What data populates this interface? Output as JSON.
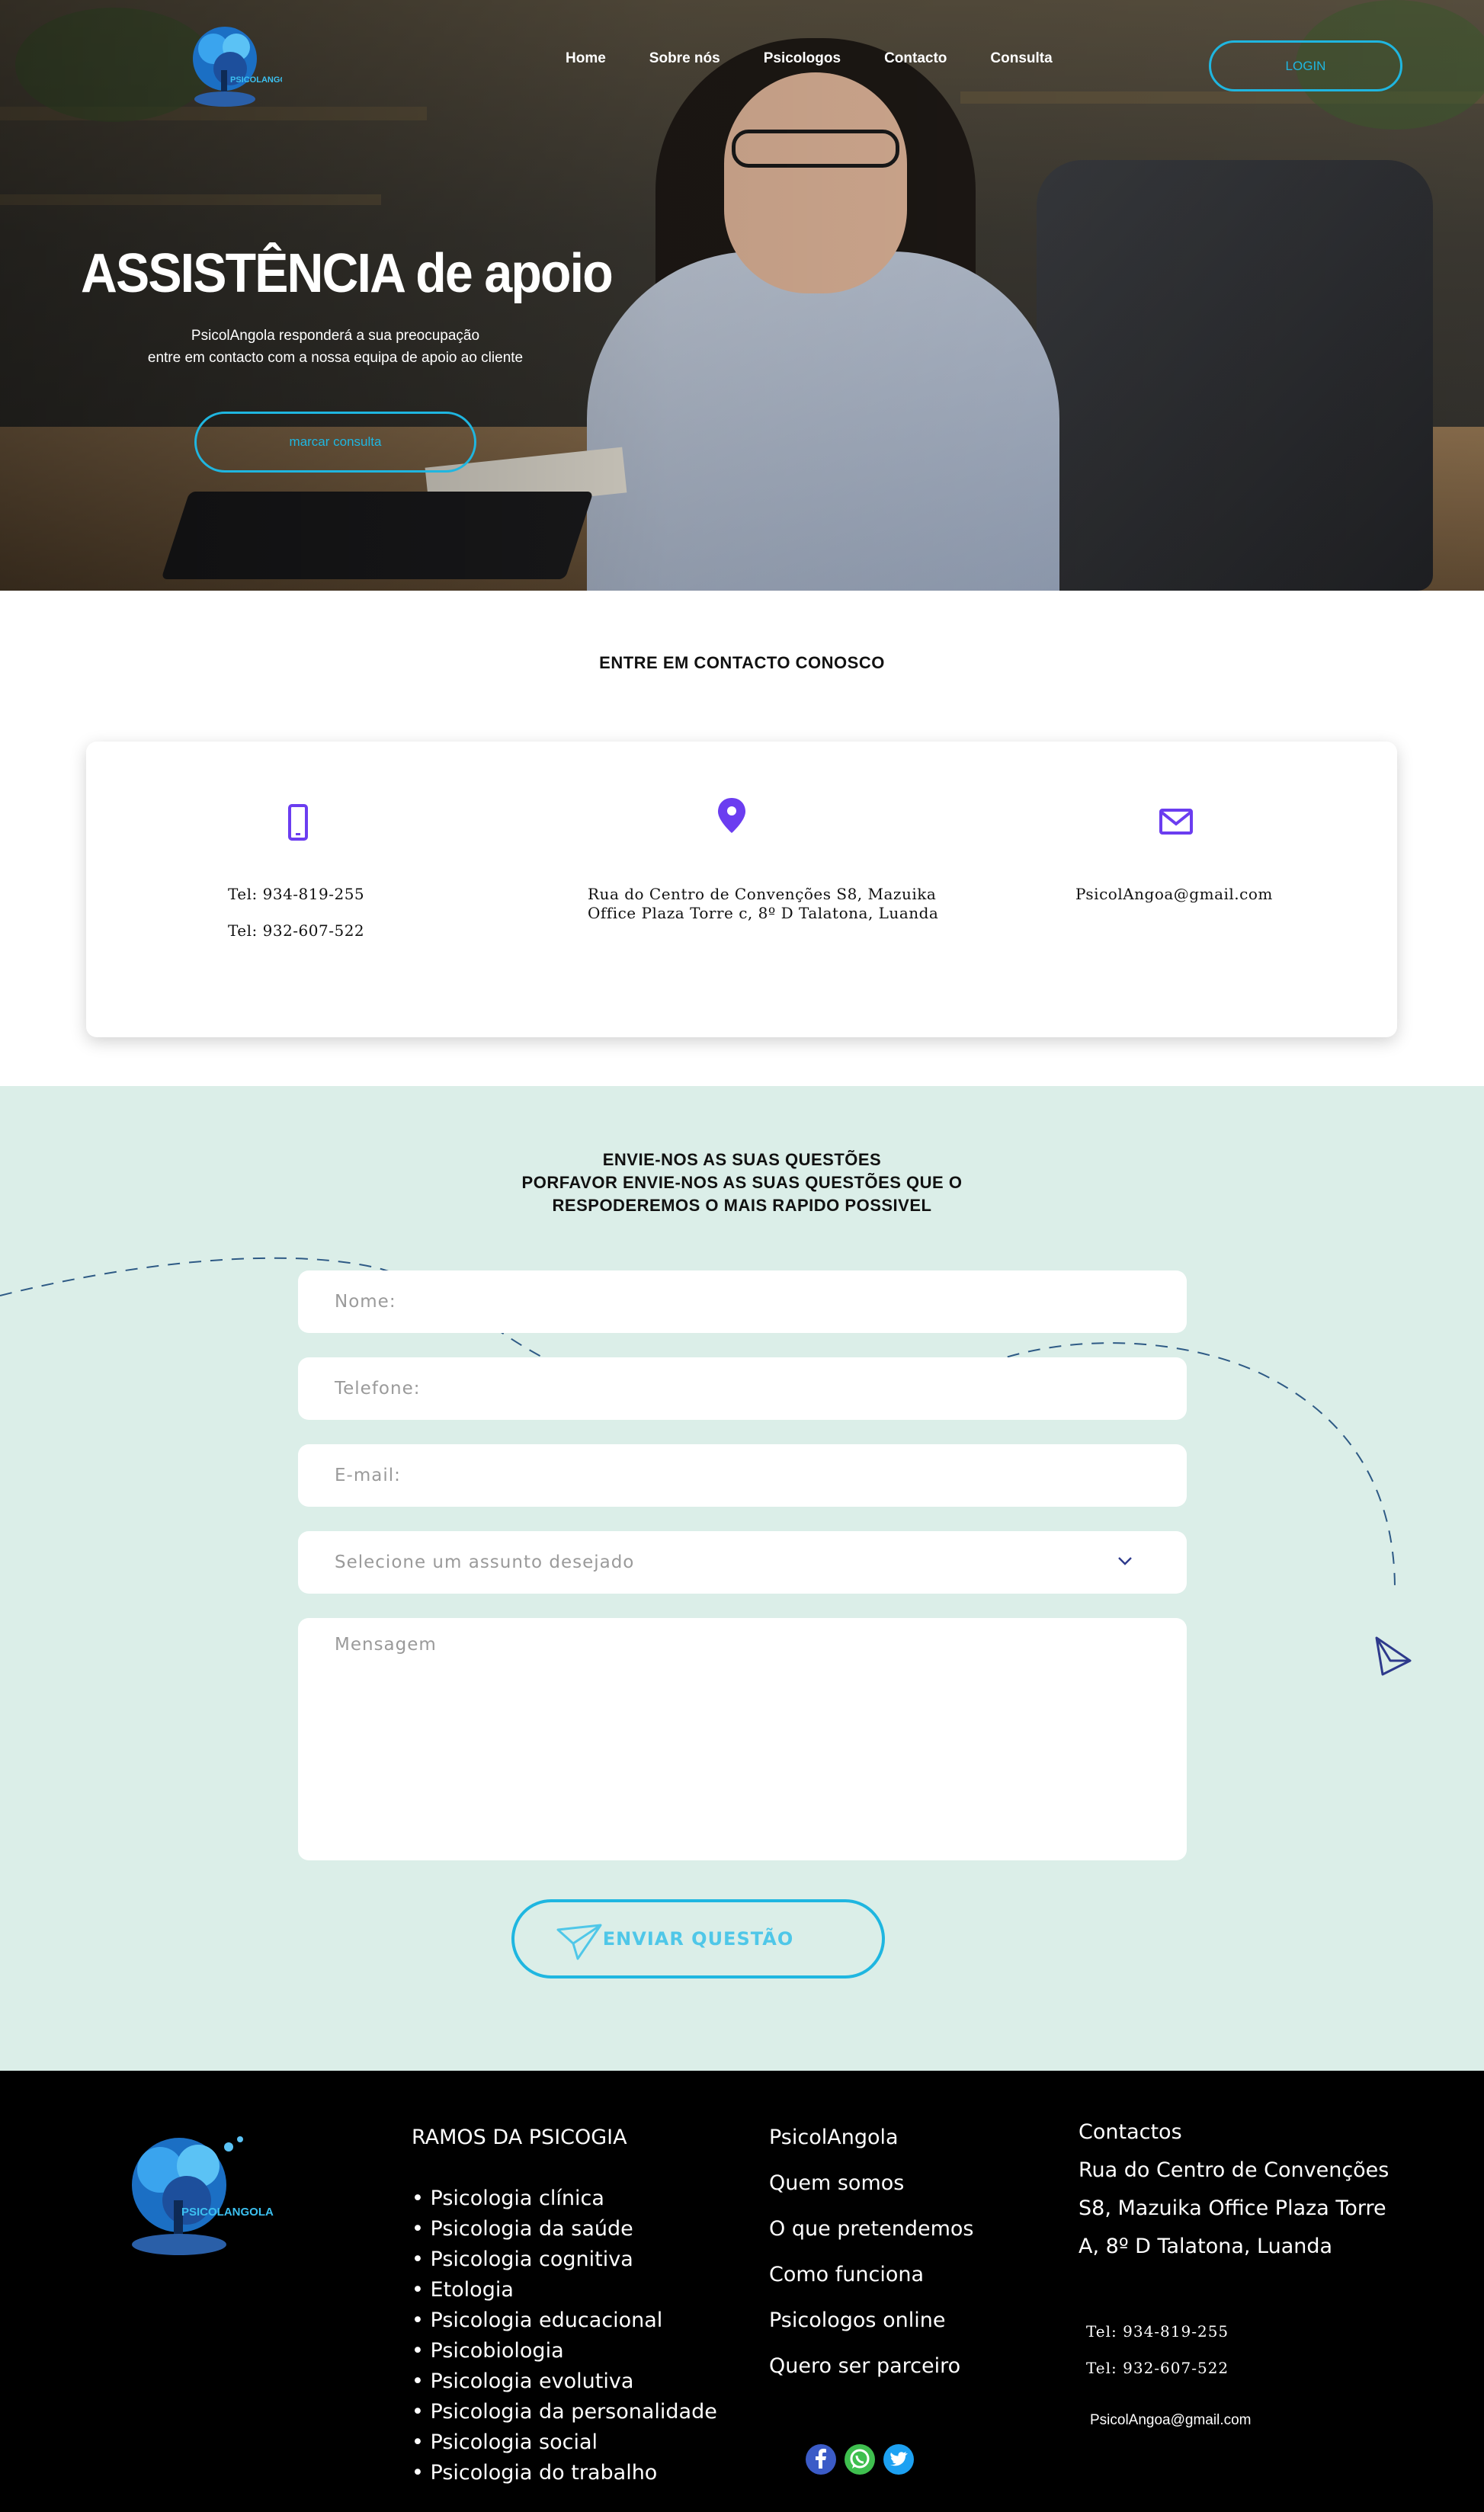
{
  "colors": {
    "accent": "#1fb6e0",
    "icon_purple": "#6b3df0",
    "form_bg": "#dbeee8",
    "footer_bg": "#000000"
  },
  "logo": {
    "text": "PSICOLANGOLA"
  },
  "nav": {
    "items": [
      {
        "label": "Home"
      },
      {
        "label": "Sobre nós"
      },
      {
        "label": "Psicologos"
      },
      {
        "label": "Contacto"
      },
      {
        "label": "Consulta"
      }
    ],
    "login_label": "LOGIN"
  },
  "hero": {
    "title": "ASSISTÊNCIA de apoio",
    "subtitle_line1": "PsicolAngola responderá a sua preocupação",
    "subtitle_line2": "entre em contacto com a nossa equipa de apoio ao cliente",
    "cta_label": "marcar consulta"
  },
  "contact": {
    "heading": "ENTRE EM CONTACTO CONOSCO",
    "phone": {
      "icon": "smartphone-icon",
      "tel1": "Tel: 934-819-255",
      "tel2": "Tel: 932-607-522"
    },
    "address": {
      "icon": "location-pin-icon",
      "line1": "Rua do Centro de Convenções S8, Mazuika",
      "line2": "Office Plaza Torre c, 8º D Talatona, Luanda"
    },
    "email": {
      "icon": "mail-icon",
      "value": "PsicolAngoa@gmail.com"
    }
  },
  "form": {
    "heading_line1": "ENVIE-NOS AS SUAS QUESTÕES",
    "heading_line2": "PORFAVOR ENVIE-NOS AS SUAS QUESTÕES QUE O",
    "heading_line3": "RESPODEREMOS O MAIS RAPIDO POSSIVEL",
    "name_placeholder": "Nome:",
    "phone_placeholder": "Telefone:",
    "email_placeholder": "E-mail:",
    "subject_placeholder": "Selecione um assunto desejado",
    "message_placeholder": "Mensagem",
    "submit_label": "ENVIAR  QUESTÃO"
  },
  "footer": {
    "logo_text": "PSICOLANGOLA",
    "branches_title": "RAMOS DA PSICOGIA",
    "branches": [
      "• Psicologia clínica",
      "• Psicologia da saúde",
      "• Psicologia cognitiva",
      "• Etologia",
      "• Psicologia educacional",
      "• Psicobiologia",
      "• Psicologia evolutiva",
      "• Psicologia da personalidade",
      "• Psicologia social",
      "• Psicologia do trabalho"
    ],
    "links": [
      "PsicolAngola",
      "Quem somos",
      "O que pretendemos",
      "Como funciona",
      "Psicologos online",
      "Quero ser parceiro"
    ],
    "contact_title": "Contactos",
    "address_line1": "Rua do Centro de Convenções",
    "address_line2": "S8, Mazuika Office Plaza Torre",
    "address_line3": "A, 8º D Talatona, Luanda",
    "tel1": "Tel: 934-819-255",
    "tel2": "Tel: 932-607-522",
    "email": "PsicolAngoa@gmail.com",
    "social": [
      "facebook-icon",
      "whatsapp-icon",
      "twitter-icon"
    ]
  }
}
